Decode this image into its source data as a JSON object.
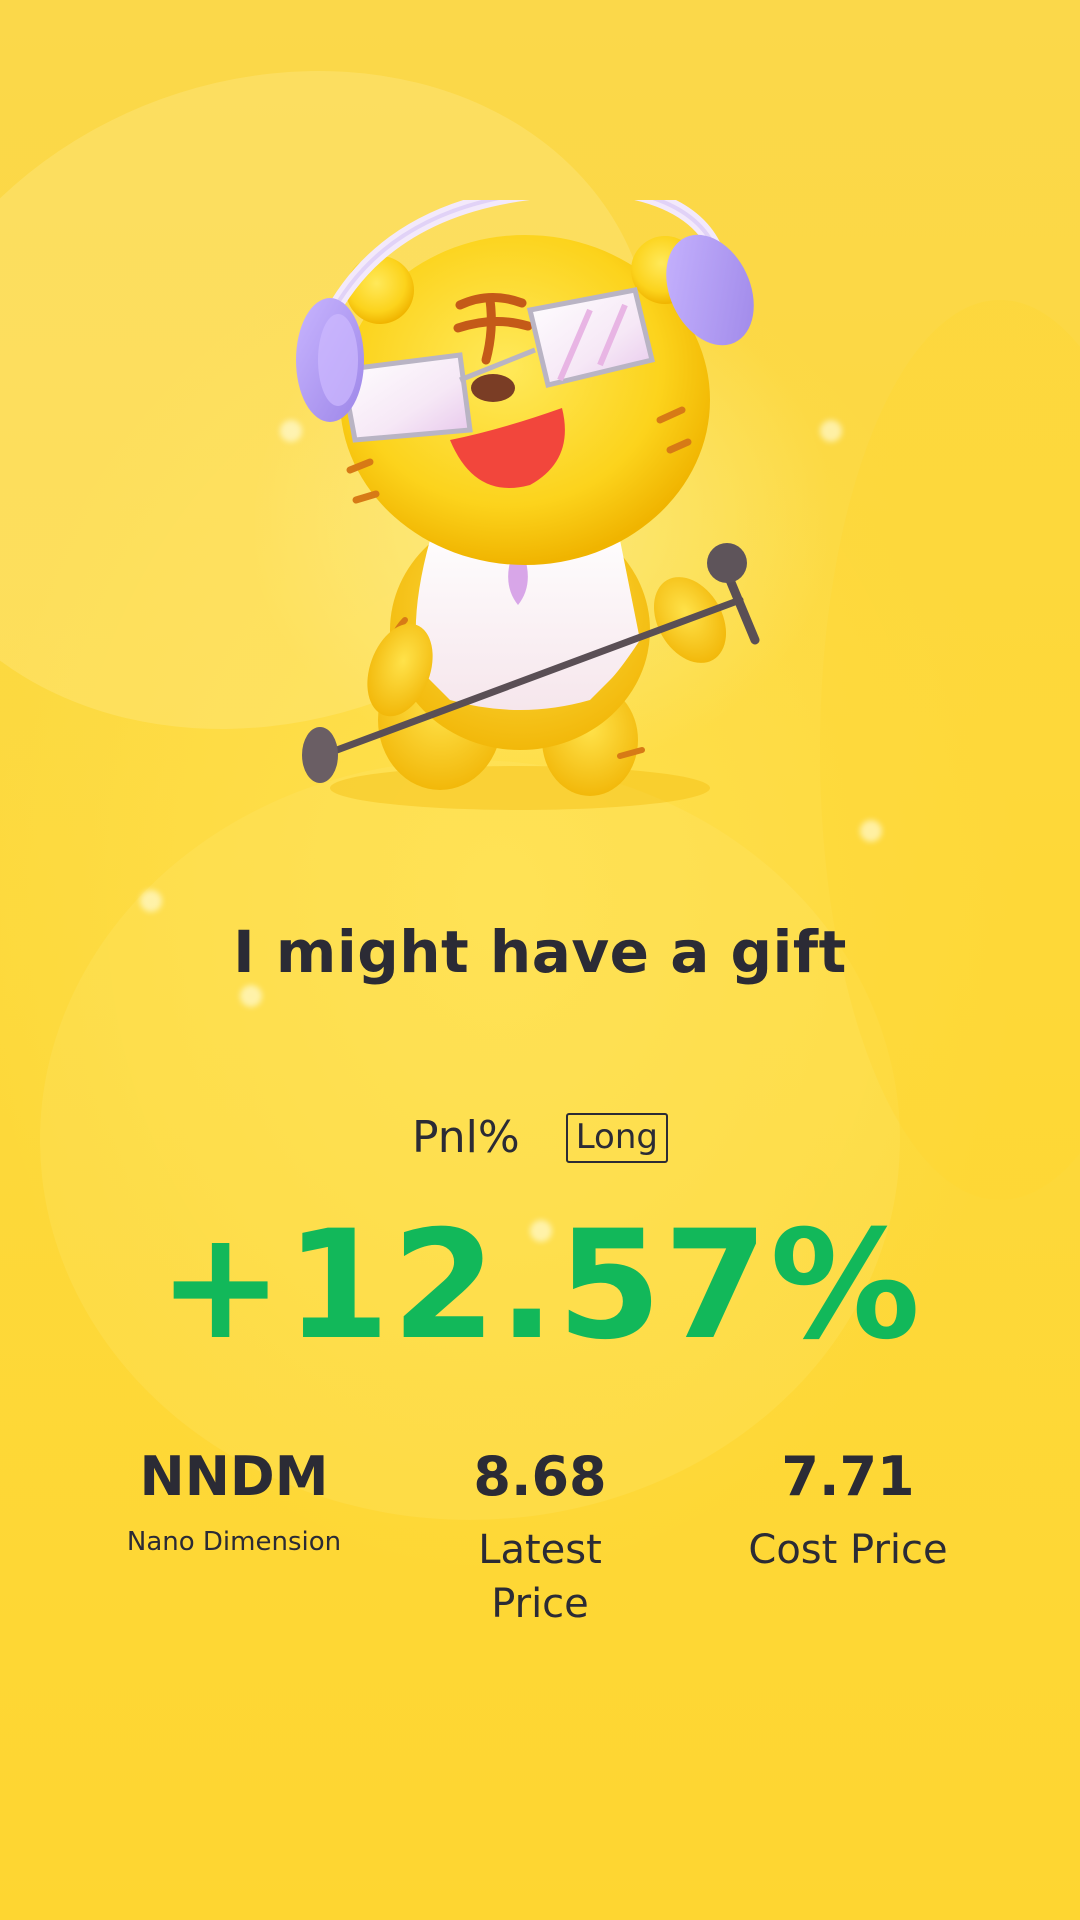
{
  "headline": "I might have a gift",
  "pnl": {
    "label": "Pnl%",
    "direction": "Long",
    "value": "+12.57%"
  },
  "stats": {
    "symbol": "NNDM",
    "company": "Nano Dimension",
    "latest_price": "8.68",
    "latest_price_label": "Latest Price",
    "cost_price": "7.71",
    "cost_price_label": "Cost Price"
  },
  "colors": {
    "background": "#fdd93c",
    "positive": "#12b85a",
    "text": "#2b2b35"
  },
  "mascot": {
    "icon": "tiger-singer-mascot-icon"
  }
}
